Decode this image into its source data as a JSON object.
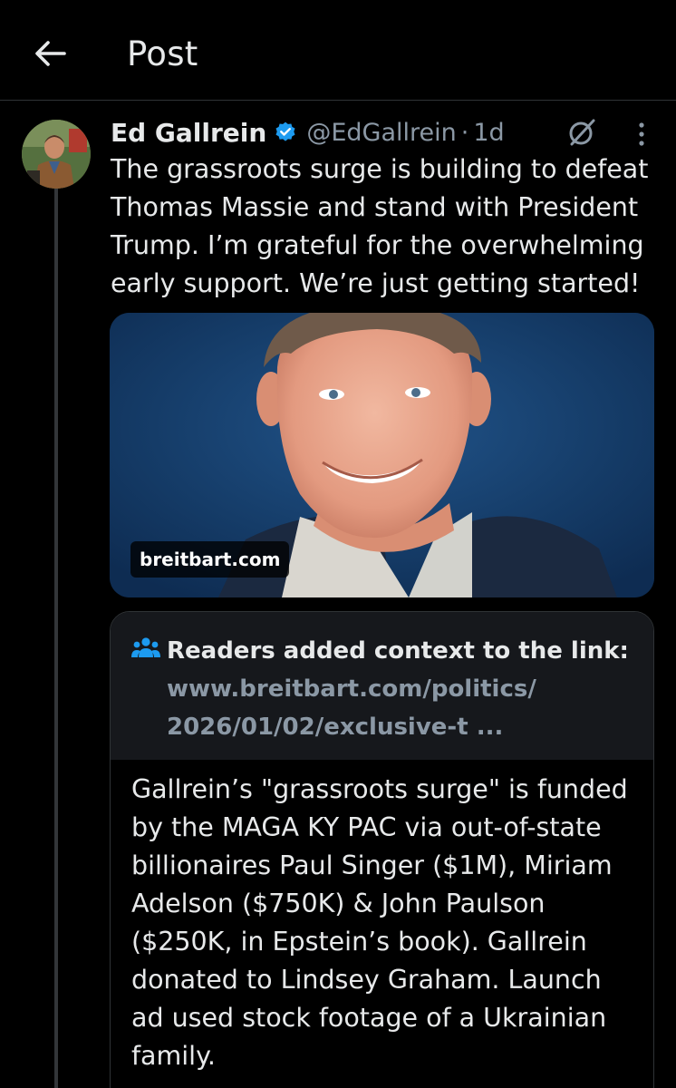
{
  "header": {
    "back_icon": "arrow-left-icon",
    "title": "Post"
  },
  "post": {
    "author_name": "Ed Gallrein",
    "verified_icon": "verified-badge-icon",
    "verified_color": "#1d9bf0",
    "handle": "@EdGallrein",
    "separator": "·",
    "time": "1d",
    "grok_icon": "grok-icon",
    "more_icon": "more-vertical-icon",
    "text": "The grassroots surge is building to defeat Thomas Massie and stand with President Trump. I’m grateful for the overwhelming early support. We’re just getting started!",
    "link_card": {
      "domain": "breitbart.com"
    }
  },
  "community_note": {
    "icon": "people-icon",
    "title_prefix": "Readers added context to the link:",
    "link_text": "www.breitbart.com/politics/ 2026/01/02/exclusive-t ...",
    "body": "Gallrein’s \"grassroots surge\" is funded by the MAGA KY PAC via out-of-state billionaires Paul Singer ($1M), Miriam Adelson ($750K) & John Paulson ($250K, in Epstein’s book). Gallrein donated to Lindsey Graham. Launch ad used stock footage of a Ukrainian family.",
    "accent_color": "#1d9bf0"
  }
}
